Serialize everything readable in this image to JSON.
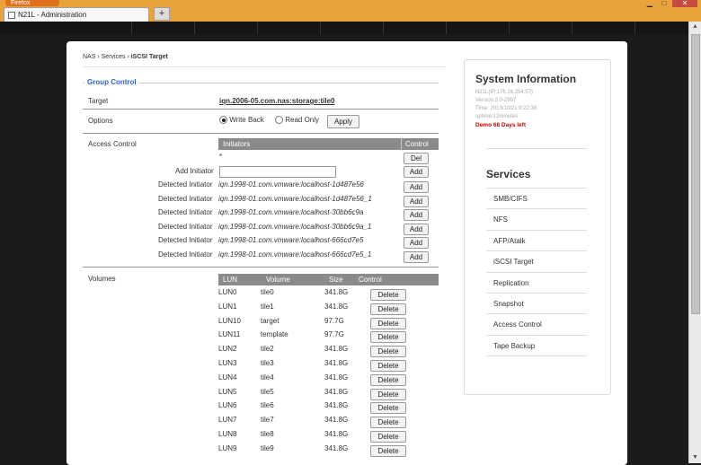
{
  "browser": {
    "app_button": "Firefox",
    "tab_title": "N21L - Administration",
    "new_tab": "+",
    "win_min": "▁",
    "win_max": "□",
    "win_close": "✕"
  },
  "breadcrumb": [
    "NAS",
    "Services",
    "iSCSI Target"
  ],
  "group_control": {
    "legend": "Group Control",
    "target_label": "Target",
    "target_value": "iqn.2006-05.com.nas:storage:tile0",
    "options_label": "Options",
    "option_write_back": "Write Back",
    "option_read_only": "Read Only",
    "selected_option": "Write Back",
    "apply": "Apply",
    "access_label": "Access Control",
    "initiators_header": "Initiators",
    "control_header": "Control",
    "wildcard": "*",
    "del": "Del",
    "add_initiator_label": "Add Initiator",
    "add_initiator_value": "",
    "add": "Add",
    "detected_label": "Detected Initiator",
    "detected": [
      "iqn.1998-01.com.vmware:localhost-1d487e56",
      "iqn.1998-01.com.vmware:localhost-1d487e56_1",
      "iqn.1998-01.com.vmware:localhost-30bb6c9a",
      "iqn.1998-01.com.vmware:localhost-30bb6c9a_1",
      "iqn.1998-01.com.vmware:localhost-666cd7e5",
      "iqn.1998-01.com.vmware:localhost-666cd7e5_1"
    ]
  },
  "volumes": {
    "label": "Volumes",
    "headers": [
      "LUN",
      "Volume",
      "Size",
      "Control"
    ],
    "delete": "Delete",
    "rows": [
      [
        "LUN0",
        "tile0",
        "341.8G"
      ],
      [
        "LUN1",
        "tile1",
        "341.8G"
      ],
      [
        "LUN10",
        "target",
        "97.7G"
      ],
      [
        "LUN11",
        "template",
        "97.7G"
      ],
      [
        "LUN2",
        "tile2",
        "341.8G"
      ],
      [
        "LUN3",
        "tile3",
        "341.8G"
      ],
      [
        "LUN4",
        "tile4",
        "341.8G"
      ],
      [
        "LUN5",
        "tile5",
        "341.8G"
      ],
      [
        "LUN6",
        "tile6",
        "341.8G"
      ],
      [
        "LUN7",
        "tile7",
        "341.8G"
      ],
      [
        "LUN8",
        "tile8",
        "341.8G"
      ],
      [
        "LUN9",
        "tile9",
        "341.8G"
      ]
    ]
  },
  "system_info": {
    "title": "System Information",
    "lines": [
      "N21L(IP:176.16.254.57)",
      "Version:2.0-2997",
      "Time: 2013/10/21 9:22:38",
      "uptime:12minutes"
    ],
    "demo": "Demo 68 Days left"
  },
  "services": {
    "title": "Services",
    "items": [
      "SMB/CIFS",
      "NFS",
      "AFP/Atalk",
      "iSCSI Target",
      "Replication",
      "Snapshot",
      "Access Control",
      "Tape Backup"
    ]
  },
  "colors": {
    "legend_blue": "#2f66c2",
    "titlebar_orange": "#e8a33c",
    "table_header_gray": "#8a8a8a",
    "demo_red": "#cc0000"
  }
}
